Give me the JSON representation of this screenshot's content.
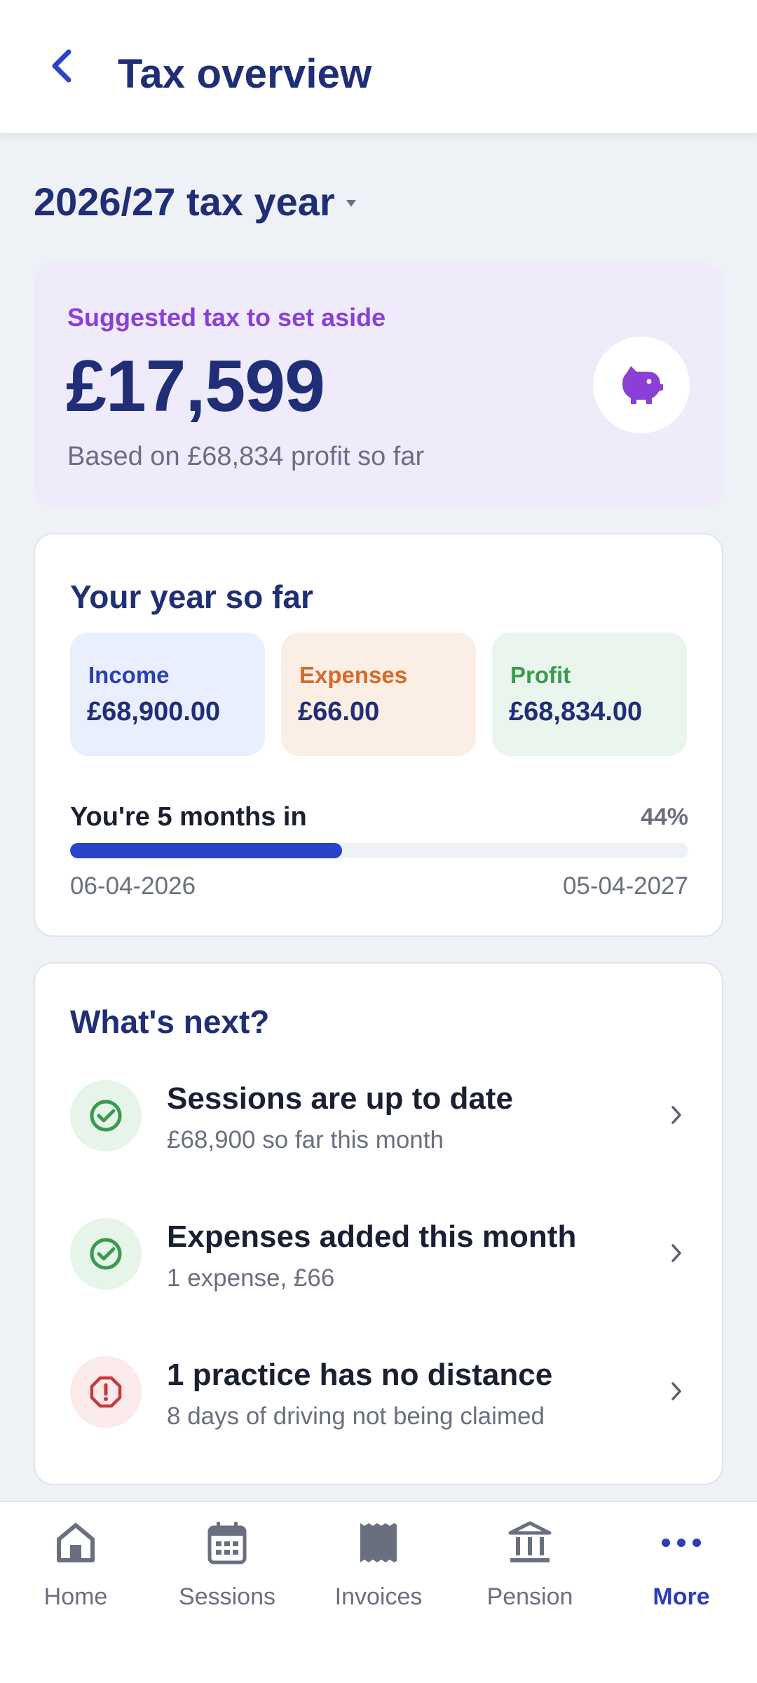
{
  "header": {
    "title": "Tax overview",
    "back_icon": "chevron-left-icon"
  },
  "year_selector": {
    "label": "2026/27 tax year",
    "caret_icon": "caret-down-icon"
  },
  "tax_card": {
    "label": "Suggested tax to set aside",
    "amount": "£17,599",
    "basis": "Based on £68,834 profit so far",
    "icon": "piggy-bank-icon",
    "accent_color": "#8a3fd6"
  },
  "year_so_far": {
    "title": "Your year so far",
    "stats": [
      {
        "label": "Income",
        "value": "£68,900.00",
        "color": "#2b3fb1"
      },
      {
        "label": "Expenses",
        "value": "£66.00",
        "color": "#d76a2a"
      },
      {
        "label": "Profit",
        "value": "£68,834.00",
        "color": "#3a9a4d"
      }
    ],
    "progress": {
      "label": "You're 5 months in",
      "percent_text": "44%",
      "fraction": 0.44,
      "start_date": "06-04-2026",
      "end_date": "05-04-2027",
      "color": "#2a44c9"
    }
  },
  "whats_next": {
    "title": "What's next?",
    "items": [
      {
        "title": "Sessions are up to date",
        "subtitle": "£68,900 so far this month",
        "status": "ok",
        "icon": "check-circle-icon"
      },
      {
        "title": "Expenses added this month",
        "subtitle": "1 expense, £66",
        "status": "ok",
        "icon": "check-circle-icon"
      },
      {
        "title": "1 practice has no distance",
        "subtitle": "8 days of driving not being claimed",
        "status": "warning",
        "icon": "alert-octagon-icon"
      }
    ]
  },
  "bottom_nav": {
    "items": [
      {
        "label": "Home",
        "icon": "home-icon",
        "active": false
      },
      {
        "label": "Sessions",
        "icon": "calendar-icon",
        "active": false
      },
      {
        "label": "Invoices",
        "icon": "receipt-icon",
        "active": false
      },
      {
        "label": "Pension",
        "icon": "bank-icon",
        "active": false
      },
      {
        "label": "More",
        "icon": "more-dots-icon",
        "active": true
      }
    ]
  }
}
